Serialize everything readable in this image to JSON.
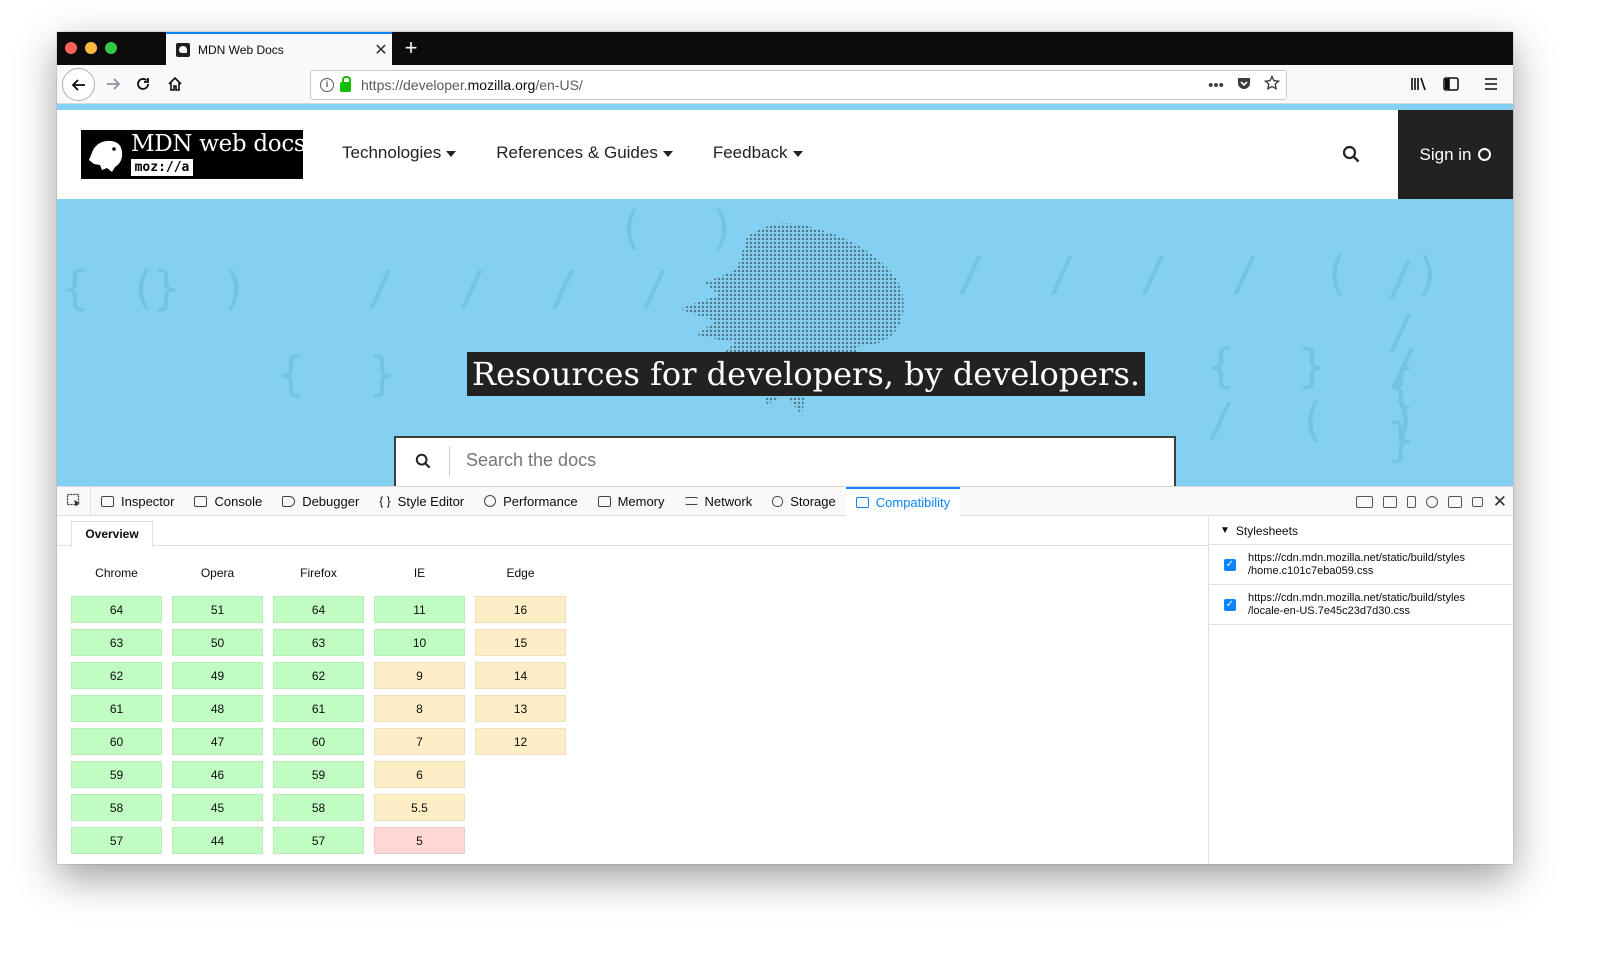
{
  "browser": {
    "tab_title": "MDN Web Docs",
    "url_host_prefix": "https://developer.",
    "url_host_bold": "mozilla.org",
    "url_path": "/en-US/",
    "url_more": "•••"
  },
  "mdn": {
    "logo_title": "MDN web docs",
    "logo_sub": "moz://a",
    "nav": [
      "Technologies",
      "References & Guides",
      "Feedback"
    ],
    "signin_label": "Sign in",
    "tagline": "Resources for developers, by developers.",
    "search_placeholder": "Search the docs"
  },
  "devtools": {
    "tabs": [
      "Inspector",
      "Console",
      "Debugger",
      "Style Editor",
      "Performance",
      "Memory",
      "Network",
      "Storage",
      "Compatibility"
    ],
    "active_tab": "Compatibility",
    "subtab": "Overview",
    "sidebar_title": "Stylesheets",
    "stylesheets": [
      {
        "line1": "https://cdn.mdn.mozilla.net/static/build/styles",
        "line2": "/home.c101c7eba059.css"
      },
      {
        "line1": "https://cdn.mdn.mozilla.net/static/build/styles",
        "line2": "/locale-en-US.7e45c23d7d30.css"
      }
    ]
  },
  "compat": {
    "browsers": [
      {
        "name": "Chrome",
        "versions": [
          {
            "v": "64",
            "s": "green"
          },
          {
            "v": "63",
            "s": "green"
          },
          {
            "v": "62",
            "s": "green"
          },
          {
            "v": "61",
            "s": "green"
          },
          {
            "v": "60",
            "s": "green"
          },
          {
            "v": "59",
            "s": "green"
          },
          {
            "v": "58",
            "s": "green"
          },
          {
            "v": "57",
            "s": "green"
          }
        ]
      },
      {
        "name": "Opera",
        "versions": [
          {
            "v": "51",
            "s": "green"
          },
          {
            "v": "50",
            "s": "green"
          },
          {
            "v": "49",
            "s": "green"
          },
          {
            "v": "48",
            "s": "green"
          },
          {
            "v": "47",
            "s": "green"
          },
          {
            "v": "46",
            "s": "green"
          },
          {
            "v": "45",
            "s": "green"
          },
          {
            "v": "44",
            "s": "green"
          }
        ]
      },
      {
        "name": "Firefox",
        "versions": [
          {
            "v": "64",
            "s": "green"
          },
          {
            "v": "63",
            "s": "green"
          },
          {
            "v": "62",
            "s": "green"
          },
          {
            "v": "61",
            "s": "green"
          },
          {
            "v": "60",
            "s": "green"
          },
          {
            "v": "59",
            "s": "green"
          },
          {
            "v": "58",
            "s": "green"
          },
          {
            "v": "57",
            "s": "green"
          }
        ]
      },
      {
        "name": "IE",
        "versions": [
          {
            "v": "11",
            "s": "green"
          },
          {
            "v": "10",
            "s": "green"
          },
          {
            "v": "9",
            "s": "yellow"
          },
          {
            "v": "8",
            "s": "yellow"
          },
          {
            "v": "7",
            "s": "yellow"
          },
          {
            "v": "6",
            "s": "yellow"
          },
          {
            "v": "5.5",
            "s": "yellow"
          },
          {
            "v": "5",
            "s": "red"
          }
        ]
      },
      {
        "name": "Edge",
        "versions": [
          {
            "v": "16",
            "s": "yellow"
          },
          {
            "v": "15",
            "s": "yellow"
          },
          {
            "v": "14",
            "s": "yellow"
          },
          {
            "v": "13",
            "s": "yellow"
          },
          {
            "v": "12",
            "s": "yellow"
          }
        ]
      }
    ]
  },
  "colors": {
    "accent": "#0a84ff",
    "hero_bg": "#83d0f2",
    "supported": "#c1fdc3",
    "partial": "#fdeec5",
    "unsupported": "#ffd7d4"
  }
}
